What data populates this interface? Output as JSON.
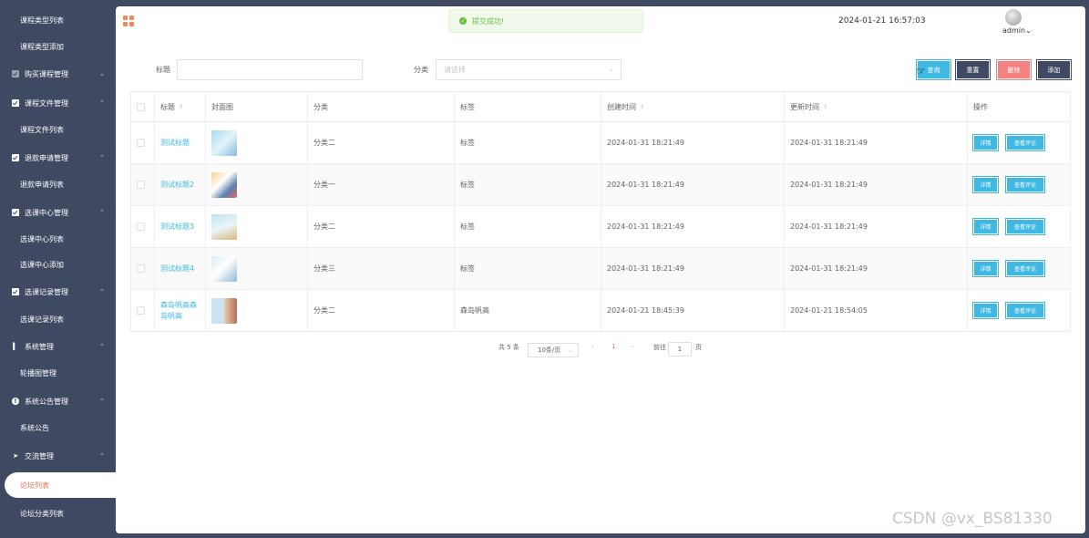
{
  "sidebar": {
    "items": [
      {
        "type": "sub",
        "label": "课程类型列表"
      },
      {
        "type": "sub",
        "label": "课程类型添加"
      },
      {
        "type": "group",
        "label": "购买课程管理",
        "icon": "checkbox-gray-icon",
        "chevron": "down"
      },
      {
        "type": "group",
        "label": "课程文件管理",
        "icon": "checkbox-icon",
        "chevron": "up"
      },
      {
        "type": "sub",
        "label": "课程文件列表"
      },
      {
        "type": "group",
        "label": "退款申请管理",
        "icon": "checkbox-icon",
        "chevron": "up"
      },
      {
        "type": "sub",
        "label": "退款申请列表"
      },
      {
        "type": "group",
        "label": "选课中心管理",
        "icon": "checkbox-icon",
        "chevron": "up"
      },
      {
        "type": "sub",
        "label": "选课中心列表"
      },
      {
        "type": "sub",
        "label": "选课中心添加"
      },
      {
        "type": "group",
        "label": "选课记录管理",
        "icon": "checkbox-icon",
        "chevron": "up"
      },
      {
        "type": "sub",
        "label": "选课记录列表"
      },
      {
        "type": "group",
        "label": "系统管理",
        "icon": "bar-chart-icon",
        "chevron": "up"
      },
      {
        "type": "sub",
        "label": "轮播图管理"
      },
      {
        "type": "group",
        "label": "系统公告管理",
        "icon": "info-icon",
        "chevron": "up"
      },
      {
        "type": "sub",
        "label": "系统公告"
      },
      {
        "type": "group",
        "label": "交流管理",
        "icon": "send-icon",
        "chevron": "up"
      },
      {
        "type": "active",
        "label": "论坛列表"
      },
      {
        "type": "sub",
        "label": "论坛分类列表"
      }
    ]
  },
  "header": {
    "toast": "提交成功!",
    "datetime": "2024-01-21 16:57:03",
    "user": "admin"
  },
  "search": {
    "title_label": "标题",
    "title_value": "",
    "category_label": "分类",
    "category_placeholder": "请选择",
    "search_btn": "查询",
    "reset_btn": "重置",
    "delete_btn": "删除",
    "add_btn": "添加"
  },
  "table": {
    "headers": [
      "标题",
      "封面图",
      "分类",
      "标签",
      "创建时间",
      "更新时间",
      "操作"
    ],
    "detail_label": "详情",
    "comment_label": "查看评论",
    "rows": [
      {
        "title": "测试标题",
        "category": "分类二",
        "tag": "标签",
        "created": "2024-01-31 18:21:49",
        "updated": "2024-01-31 18:21:49"
      },
      {
        "title": "测试标题2",
        "category": "分类一",
        "tag": "标签",
        "created": "2024-01-31 18:21:49",
        "updated": "2024-01-31 18:21:49"
      },
      {
        "title": "测试标题3",
        "category": "分类二",
        "tag": "标签",
        "created": "2024-01-31 18:21:49",
        "updated": "2024-01-31 18:21:49"
      },
      {
        "title": "测试标题4",
        "category": "分类三",
        "tag": "标签",
        "created": "2024-01-31 18:21:49",
        "updated": "2024-01-31 18:21:49"
      },
      {
        "title": "森岛帆高森岛帆高",
        "category": "分类二",
        "tag": "森岛帆高",
        "created": "2024-01-21 18:45:39",
        "updated": "2024-01-21 18:54:05"
      }
    ]
  },
  "pagination": {
    "total": "共 5 条",
    "page_size": "10条/页",
    "current_page": "1",
    "goto_label": "前往",
    "goto_value": "1",
    "page_suffix": "页"
  },
  "watermark": "CSDN @vx_BS81330"
}
